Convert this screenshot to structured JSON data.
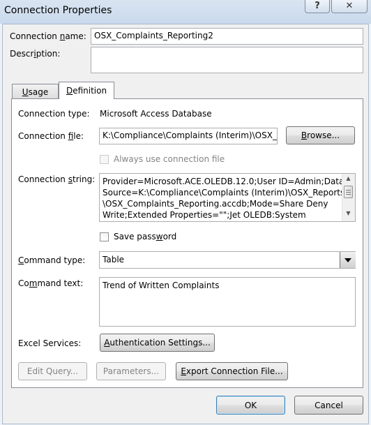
{
  "window": {
    "title": "Connection Properties",
    "help_label": "?",
    "close_label": "✕"
  },
  "header": {
    "name_label_prefix": "Connection ",
    "name_label_accel": "n",
    "name_label_suffix": "ame:",
    "name_value": "OSX_Complaints_Reporting2",
    "description_label_prefix": "Descr",
    "description_label_accel": "i",
    "description_label_suffix": "ption:",
    "description_value": ""
  },
  "tabs": [
    {
      "label_accel": "U",
      "label_rest": "sage",
      "active": false
    },
    {
      "label_accel": "D",
      "label_rest": "efinition",
      "active": true
    }
  ],
  "definition": {
    "connection_type_label": "Connection type:",
    "connection_type_value": "Microsoft Access Database",
    "connection_file_label_prefix": "Connection ",
    "connection_file_label_accel": "f",
    "connection_file_label_suffix": "ile:",
    "connection_file_value": "K:\\Compliance\\Complaints (Interim)\\OSX_R",
    "browse_accel": "B",
    "browse_rest": "rowse...",
    "always_use_label": "Always use connection file",
    "always_use_checked": false,
    "connection_string_label_prefix": "Connection ",
    "connection_string_label_accel": "s",
    "connection_string_label_suffix": "tring:",
    "connection_string_lines": [
      "Provider=Microsoft.ACE.OLEDB.12.0;User ID=Admin;Data",
      "Source=K:\\Compliance\\Complaints (Interim)\\OSX_Reports",
      "\\OSX_Complaints_Reporting.accdb;Mode=Share Deny",
      "Write;Extended Properties=\"\";Jet OLEDB:System"
    ],
    "save_password_prefix": "Save pass",
    "save_password_accel": "w",
    "save_password_suffix": "ord",
    "save_password_checked": false,
    "command_type_label_accel": "C",
    "command_type_label_rest": "ommand type:",
    "command_type_value": "Table",
    "command_text_label_prefix": "Co",
    "command_text_label_accel": "m",
    "command_text_label_suffix": "mand text:",
    "command_text_value": "Trend of Written Complaints",
    "excel_services_label": "Excel Services:",
    "auth_settings_accel": "A",
    "auth_settings_rest": "uthentication Settings...",
    "edit_query_label": "Edit Query...",
    "parameters_label": "Parameters...",
    "export_accel": "E",
    "export_rest": "xport Connection File..."
  },
  "footer": {
    "ok_label": "OK",
    "cancel_label": "Cancel"
  }
}
